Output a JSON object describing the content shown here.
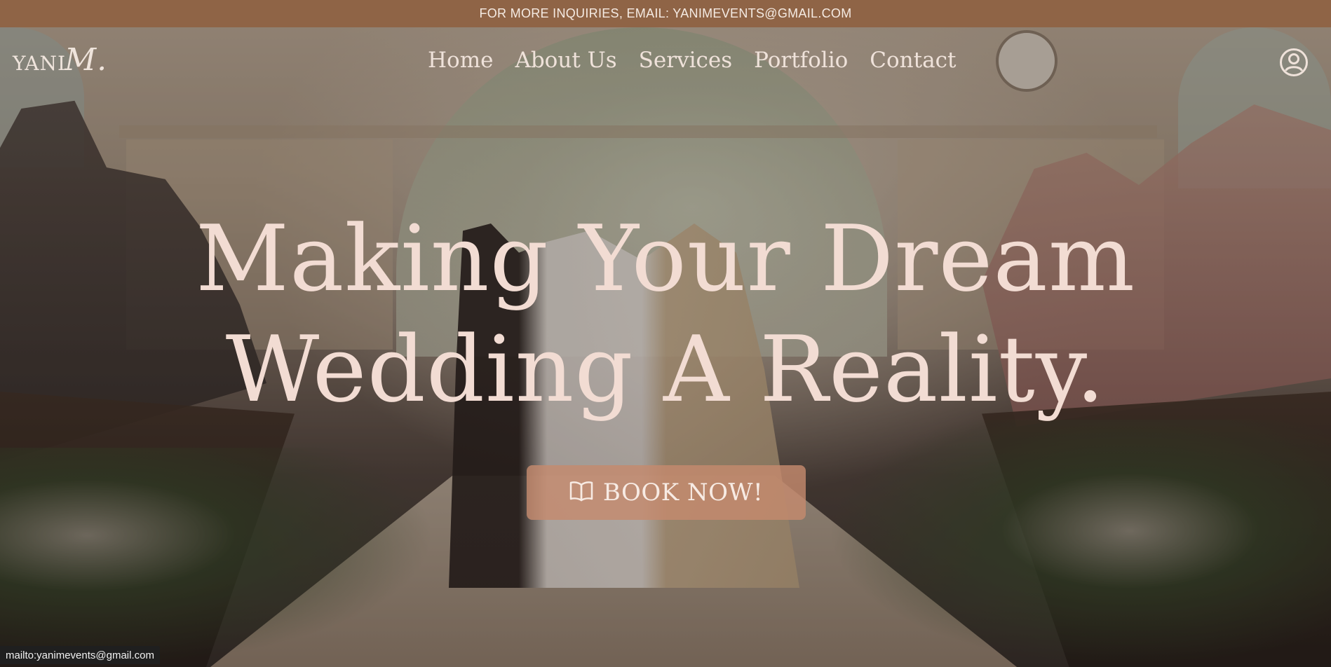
{
  "topbar": {
    "text": "FOR MORE INQUIRIES, EMAIL: YANIMEVENTS@GMAIL.COM"
  },
  "header": {
    "logo_text": "YANI",
    "logo_flourish": "M.",
    "nav": [
      {
        "label": "Home"
      },
      {
        "label": "About Us"
      },
      {
        "label": "Services"
      },
      {
        "label": "Portfolio"
      },
      {
        "label": "Contact"
      }
    ],
    "account_icon": "user-circle-icon"
  },
  "hero": {
    "headline_line1": "Making Your Dream",
    "headline_line2": "Wedding A Reality.",
    "button_label": "BOOK NOW!",
    "button_icon": "open-book-icon"
  },
  "status_bar": {
    "text": "mailto:yanimevents@gmail.com"
  },
  "colors": {
    "topbar_bg": "#8f6446",
    "headline": "#f2dcd3",
    "button_bg": "#c48a6e",
    "nav_text": "#efe2da"
  }
}
